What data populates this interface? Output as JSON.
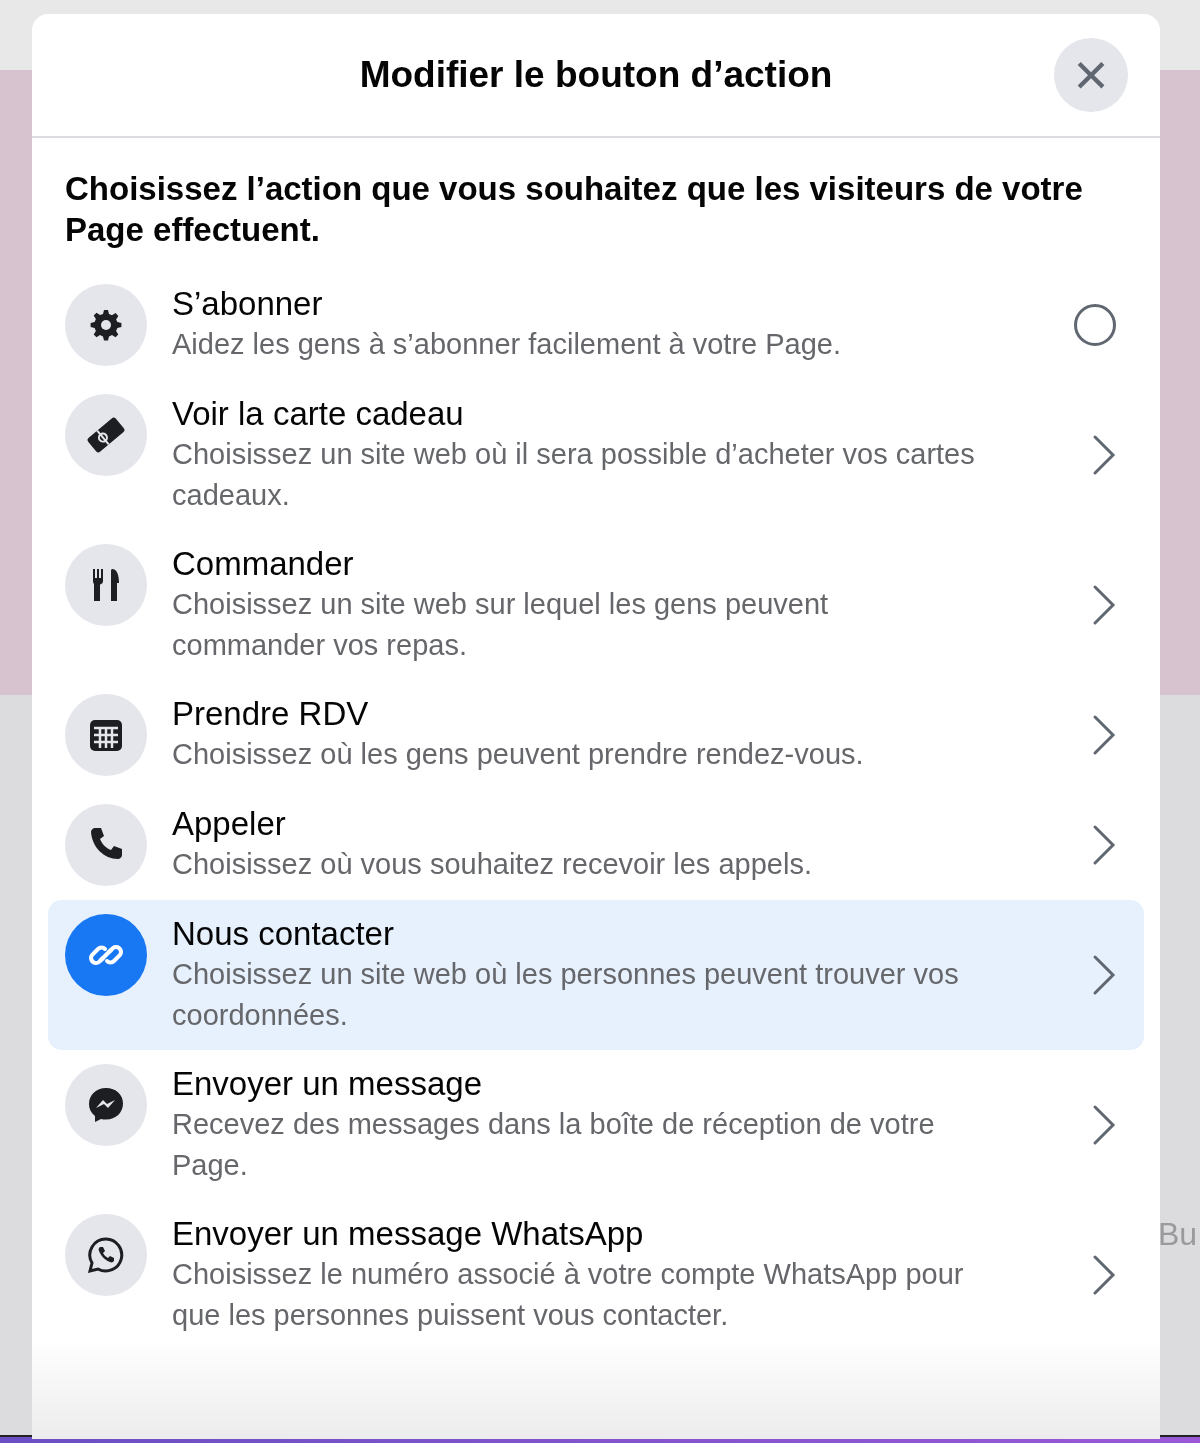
{
  "background": {
    "text": "Bu"
  },
  "dialog": {
    "title": "Modifier le bouton d’action",
    "close": "×",
    "intro": "Choisissez l’action que vous souhaitez que les visiteurs de votre Page effectuent."
  },
  "options": [
    {
      "title": "S’abonner",
      "description": "Aidez les gens à s’abonner facilement à votre Page.",
      "kind": "radio",
      "checked": false,
      "selected": false
    },
    {
      "title": "Voir la carte cadeau",
      "description": "Choisissez un site web où il sera possible d’acheter vos cartes cadeaux.",
      "kind": "chevron",
      "selected": false
    },
    {
      "title": "Commander",
      "description": "Choisissez un site web sur lequel les gens peuvent commander vos repas.",
      "kind": "chevron",
      "selected": false
    },
    {
      "title": "Prendre RDV",
      "description": "Choisissez où les gens peuvent prendre rendez-vous.",
      "kind": "chevron",
      "selected": false
    },
    {
      "title": "Appeler",
      "description": "Choisissez où vous souhaitez recevoir les appels.",
      "kind": "chevron",
      "selected": false
    },
    {
      "title": "Nous contacter",
      "description": "Choisissez un site web où les personnes peuvent trouver vos coordonnées.",
      "kind": "chevron",
      "selected": true
    },
    {
      "title": "Envoyer un message",
      "description": "Recevez des messages dans la boîte de réception de votre Page.",
      "kind": "chevron",
      "selected": false
    },
    {
      "title": "Envoyer un message WhatsApp",
      "description": "Choisissez le numéro associé à votre compte WhatsApp pour que les personnes puissent vous contacter.",
      "kind": "chevron",
      "selected": false
    }
  ]
}
